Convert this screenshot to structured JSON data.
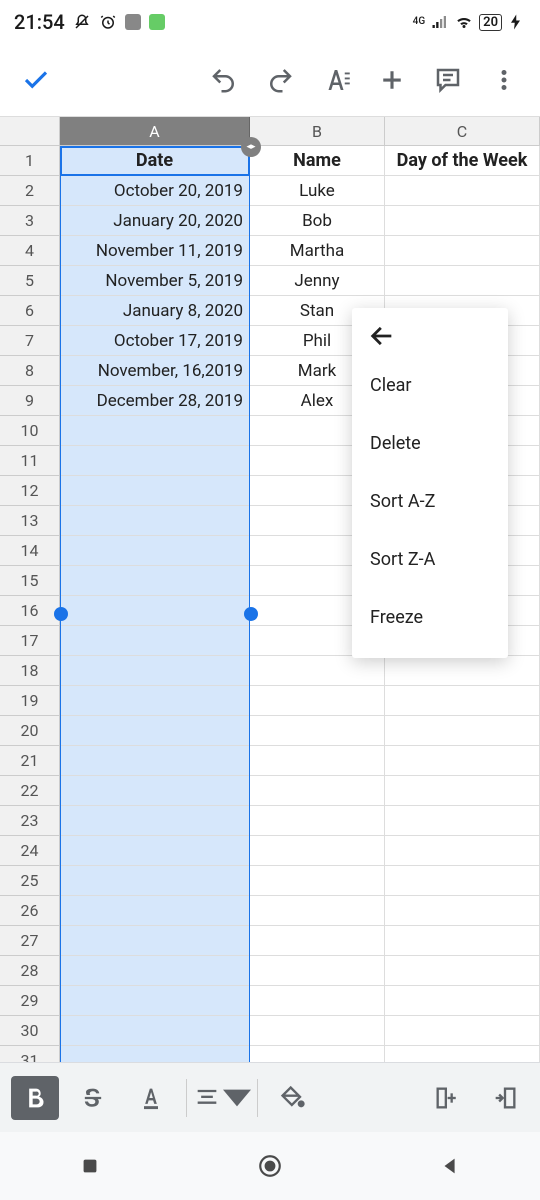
{
  "status": {
    "time": "21:54",
    "battery": "20"
  },
  "columns": [
    {
      "label": "A",
      "class": "col-A",
      "selected": true
    },
    {
      "label": "B",
      "class": "col-B",
      "selected": false
    },
    {
      "label": "C",
      "class": "col-C",
      "selected": false
    }
  ],
  "rows": [
    {
      "n": "1",
      "a": "Date",
      "b": "Name",
      "c": "Day of the Week",
      "header": true
    },
    {
      "n": "2",
      "a": "October 20, 2019",
      "b": "Luke",
      "c": ""
    },
    {
      "n": "3",
      "a": "January 20, 2020",
      "b": "Bob",
      "c": ""
    },
    {
      "n": "4",
      "a": "November 11, 2019",
      "b": "Martha",
      "c": ""
    },
    {
      "n": "5",
      "a": "November 5, 2019",
      "b": "Jenny",
      "c": ""
    },
    {
      "n": "6",
      "a": "January 8, 2020",
      "b": "Stan",
      "c": ""
    },
    {
      "n": "7",
      "a": "October 17, 2019",
      "b": "Phil",
      "c": ""
    },
    {
      "n": "8",
      "a": "November, 16,2019",
      "b": "Mark",
      "c": ""
    },
    {
      "n": "9",
      "a": "December 28, 2019",
      "b": "Alex",
      "c": ""
    },
    {
      "n": "10",
      "a": "",
      "b": "",
      "c": ""
    },
    {
      "n": "11",
      "a": "",
      "b": "",
      "c": ""
    },
    {
      "n": "12",
      "a": "",
      "b": "",
      "c": ""
    },
    {
      "n": "13",
      "a": "",
      "b": "",
      "c": ""
    },
    {
      "n": "14",
      "a": "",
      "b": "",
      "c": ""
    },
    {
      "n": "15",
      "a": "",
      "b": "",
      "c": ""
    },
    {
      "n": "16",
      "a": "",
      "b": "",
      "c": ""
    },
    {
      "n": "17",
      "a": "",
      "b": "",
      "c": ""
    },
    {
      "n": "18",
      "a": "",
      "b": "",
      "c": ""
    },
    {
      "n": "19",
      "a": "",
      "b": "",
      "c": ""
    },
    {
      "n": "20",
      "a": "",
      "b": "",
      "c": ""
    },
    {
      "n": "21",
      "a": "",
      "b": "",
      "c": ""
    },
    {
      "n": "22",
      "a": "",
      "b": "",
      "c": ""
    },
    {
      "n": "23",
      "a": "",
      "b": "",
      "c": ""
    },
    {
      "n": "24",
      "a": "",
      "b": "",
      "c": ""
    },
    {
      "n": "25",
      "a": "",
      "b": "",
      "c": ""
    },
    {
      "n": "26",
      "a": "",
      "b": "",
      "c": ""
    },
    {
      "n": "27",
      "a": "",
      "b": "",
      "c": ""
    },
    {
      "n": "28",
      "a": "",
      "b": "",
      "c": ""
    },
    {
      "n": "29",
      "a": "",
      "b": "",
      "c": ""
    },
    {
      "n": "30",
      "a": "",
      "b": "",
      "c": ""
    },
    {
      "n": "31",
      "a": "",
      "b": "",
      "c": ""
    }
  ],
  "menu": {
    "items": [
      {
        "label": "Clear"
      },
      {
        "label": "Delete"
      },
      {
        "label": "Sort A-Z"
      },
      {
        "label": "Sort Z-A"
      },
      {
        "label": "Freeze"
      }
    ]
  }
}
